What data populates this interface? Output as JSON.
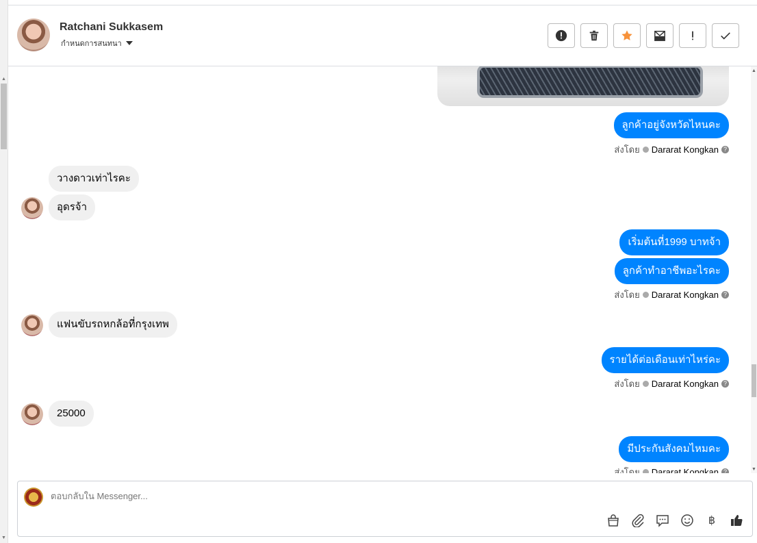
{
  "header": {
    "name": "Ratchani Sukkasem",
    "subtitle": "กำหนดการสนทนา"
  },
  "toolbar": {
    "buttons": [
      "alert-icon",
      "trash-icon",
      "star-icon",
      "mark-unread-icon",
      "exclamation-icon",
      "check-icon"
    ],
    "star_color": "#f7923a"
  },
  "messages": {
    "m1": "ลูกค้าอยู่จังหวัดไหนคะ",
    "m2": "วางดาวเท่าไรคะ",
    "m3": "อุดรจ้า",
    "m4": "เริ่มต้นที่1999 บาทจ้า",
    "m5": "ลูกค้าทำอาชีพอะไรคะ",
    "m6": "แฟนขับรถหกล้อที่กรุงเทพ",
    "m7": "รายได้ต่อเดือนเท่าไหร่คะ",
    "m8": "25000",
    "m9": "มีประกันสังคมไหมคะ"
  },
  "sent_by": {
    "label": "ส่งโดย",
    "name": "Dararat Kongkan",
    "help": "?"
  },
  "composer": {
    "placeholder": "ตอบกลับใน Messenger...",
    "baht_symbol": "฿"
  },
  "colors": {
    "outgoing": "#0084ff",
    "incoming": "#f0f0f0"
  }
}
